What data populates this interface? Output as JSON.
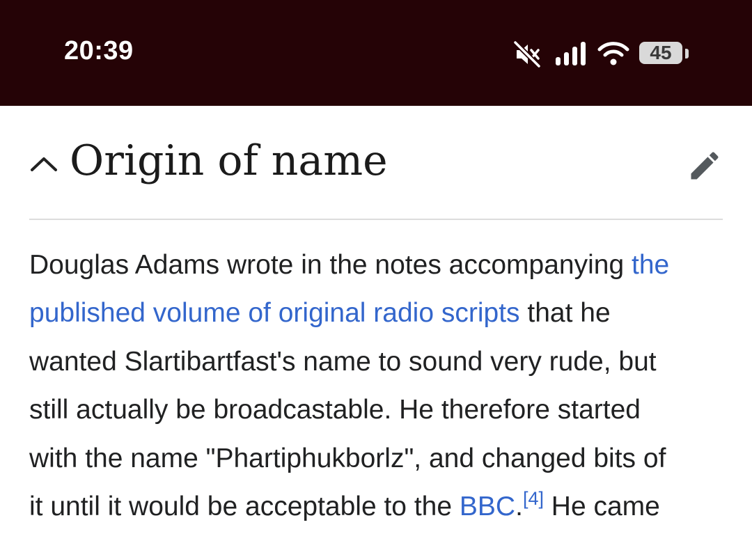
{
  "status_bar": {
    "time": "20:39",
    "battery_level": "45",
    "icons": [
      "mute-icon",
      "signal-icon",
      "wifi-icon",
      "battery-icon"
    ]
  },
  "section": {
    "title": "Origin of name",
    "collapse_icon": "chevron-up-icon",
    "edit_icon": "pencil-icon"
  },
  "paragraph": {
    "line1_text": "Douglas Adams wrote in the notes accompanying ",
    "line1_link": "the",
    "line2_link": "published volume of original radio scripts",
    "line2_text": " that he",
    "line3_text": "wanted Slartibartfast's name to sound very rude, but",
    "line4_text": "still actually be broadcastable. He therefore started",
    "line5_text": "with the name \"Phartiphukborlz\", and changed bits of",
    "line6_text": "it until it would be acceptable to the ",
    "line6_link": "BBC",
    "line6_period": ".",
    "line6_ref": "[4]",
    "line6_end": " He came"
  },
  "colors": {
    "status_bar_bg": "#250306",
    "link": "#3366cc",
    "text": "#202122",
    "divider": "#dcdcdc"
  }
}
